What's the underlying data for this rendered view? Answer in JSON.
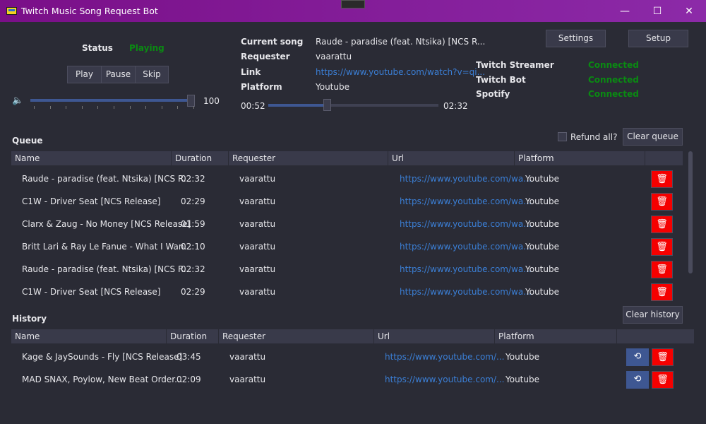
{
  "window": {
    "title": "Twitch Music Song Request Bot",
    "minimize": "—",
    "maximize": "☐",
    "close": "✕"
  },
  "player": {
    "status_label": "Status",
    "status_value": "Playing",
    "play": "Play",
    "pause": "Pause",
    "skip": "Skip",
    "volume": 100,
    "volume_text": "100"
  },
  "current": {
    "song_label": "Current song",
    "song": "Raude - paradise (feat. Ntsika) [NCS R...",
    "requester_label": "Requester",
    "requester": "vaarattu",
    "link_label": "Link",
    "link": "https://www.youtube.com/watch?v=qi...",
    "platform_label": "Platform",
    "platform": "Youtube",
    "elapsed": "00:52",
    "total": "02:32",
    "progress_percent": 34
  },
  "buttons": {
    "settings": "Settings",
    "setup": "Setup",
    "refund_all": "Refund all?",
    "clear_queue": "Clear queue",
    "clear_history": "Clear history"
  },
  "connections": [
    {
      "label": "Twitch Streamer",
      "status": "Connected"
    },
    {
      "label": "Twitch Bot",
      "status": "Connected"
    },
    {
      "label": "Spotify",
      "status": "Connected"
    }
  ],
  "colors": {
    "status_green": "#0a8a12",
    "delete_red": "#f50000",
    "accent_blue": "#3e5792",
    "titlebar": "#7a0f88"
  },
  "queue": {
    "title": "Queue",
    "columns": [
      "Name",
      "Duration",
      "Requester",
      "Url",
      "Platform"
    ],
    "rows": [
      [
        "Raude - paradise (feat. Ntsika) [NCS R...",
        "02:32",
        "vaarattu",
        "https://www.youtube.com/wa...",
        "Youtube"
      ],
      [
        "C1W - Driver Seat [NCS Release]",
        "02:29",
        "vaarattu",
        "https://www.youtube.com/wa...",
        "Youtube"
      ],
      [
        "Clarx & Zaug - No Money [NCS Release]",
        "01:59",
        "vaarattu",
        "https://www.youtube.com/wa...",
        "Youtube"
      ],
      [
        "Britt Lari & Ray Le Fanue - What I Wan...",
        "02:10",
        "vaarattu",
        "https://www.youtube.com/wa...",
        "Youtube"
      ],
      [
        "Raude - paradise (feat. Ntsika) [NCS R...",
        "02:32",
        "vaarattu",
        "https://www.youtube.com/wa...",
        "Youtube"
      ],
      [
        "C1W - Driver Seat [NCS Release]",
        "02:29",
        "vaarattu",
        "https://www.youtube.com/wa...",
        "Youtube"
      ]
    ]
  },
  "history": {
    "title": "History",
    "columns": [
      "Name",
      "Duration",
      "Requester",
      "Url",
      "Platform"
    ],
    "rows": [
      [
        "Kage & JaySounds - Fly [NCS Release]",
        "03:45",
        "vaarattu",
        "https://www.youtube.com/...",
        "Youtube"
      ],
      [
        "MAD SNAX, Poylow, New Beat Order...",
        "02:09",
        "vaarattu",
        "https://www.youtube.com/...",
        "Youtube"
      ]
    ]
  },
  "icons": {
    "delete": "trash-icon",
    "replay": "replay-icon",
    "volume": "speaker-icon"
  }
}
